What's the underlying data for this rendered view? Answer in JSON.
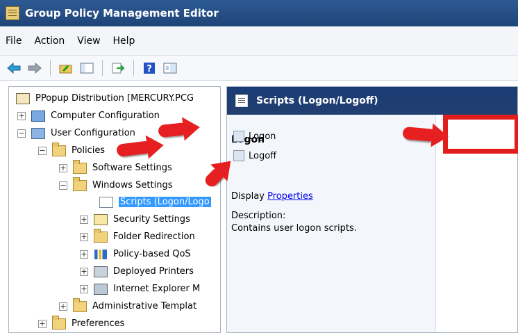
{
  "window": {
    "title": "Group Policy Management Editor"
  },
  "menu": {
    "items": [
      "File",
      "Action",
      "View",
      "Help"
    ]
  },
  "tree": {
    "root": "PPopup Distribution [MERCURY.PCG",
    "items": [
      {
        "label": "Computer Configuration"
      },
      {
        "label": "User Configuration"
      },
      {
        "label": "Policies"
      },
      {
        "label": "Software Settings"
      },
      {
        "label": "Windows Settings"
      },
      {
        "label": "Scripts (Logon/Logo"
      },
      {
        "label": "Security Settings"
      },
      {
        "label": "Folder Redirection"
      },
      {
        "label": "Policy-based QoS"
      },
      {
        "label": "Deployed Printers"
      },
      {
        "label": "Internet Explorer M"
      },
      {
        "label": "Administrative Templat"
      },
      {
        "label": "Preferences"
      }
    ]
  },
  "details": {
    "header": "Scripts (Logon/Logoff)",
    "panel_title": "Logon",
    "display_label": "Display",
    "properties_link": "Properties",
    "description_label": "Description:",
    "description_text": "Contains user logon scripts."
  },
  "list": {
    "items": [
      "Logon",
      "Logoff"
    ]
  },
  "colors": {
    "title_blue": "#1e4478",
    "highlight_red": "#e21d1d",
    "selected_blue": "#3399ff"
  }
}
